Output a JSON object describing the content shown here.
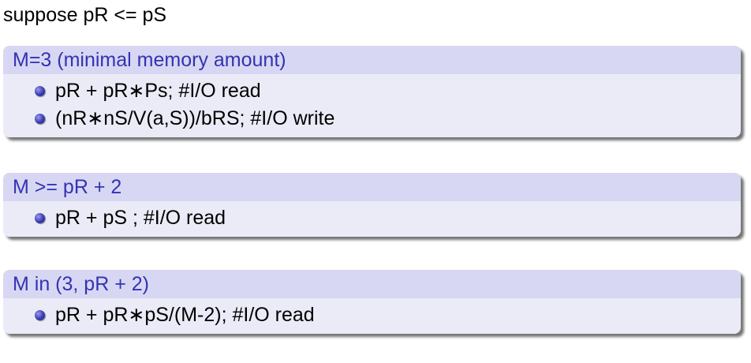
{
  "intro": "suppose pR <= pS",
  "colors": {
    "block_title_bg": "#d7d7f3",
    "block_title_text": "#3333b3",
    "block_body_bg": "#ebebf7",
    "bullet": "#3a3ab8"
  },
  "blocks": [
    {
      "title": "M=3 (minimal memory amount)",
      "items": [
        "pR + pR∗Ps; #I/O read",
        "(nR∗nS/V(a,S))/bRS; #I/O write"
      ]
    },
    {
      "title": "M >= pR + 2",
      "items": [
        "pR + pS ; #I/O read"
      ]
    },
    {
      "title": "M in (3, pR + 2)",
      "items": [
        "pR + pR∗pS/(M-2); #I/O read"
      ]
    }
  ]
}
